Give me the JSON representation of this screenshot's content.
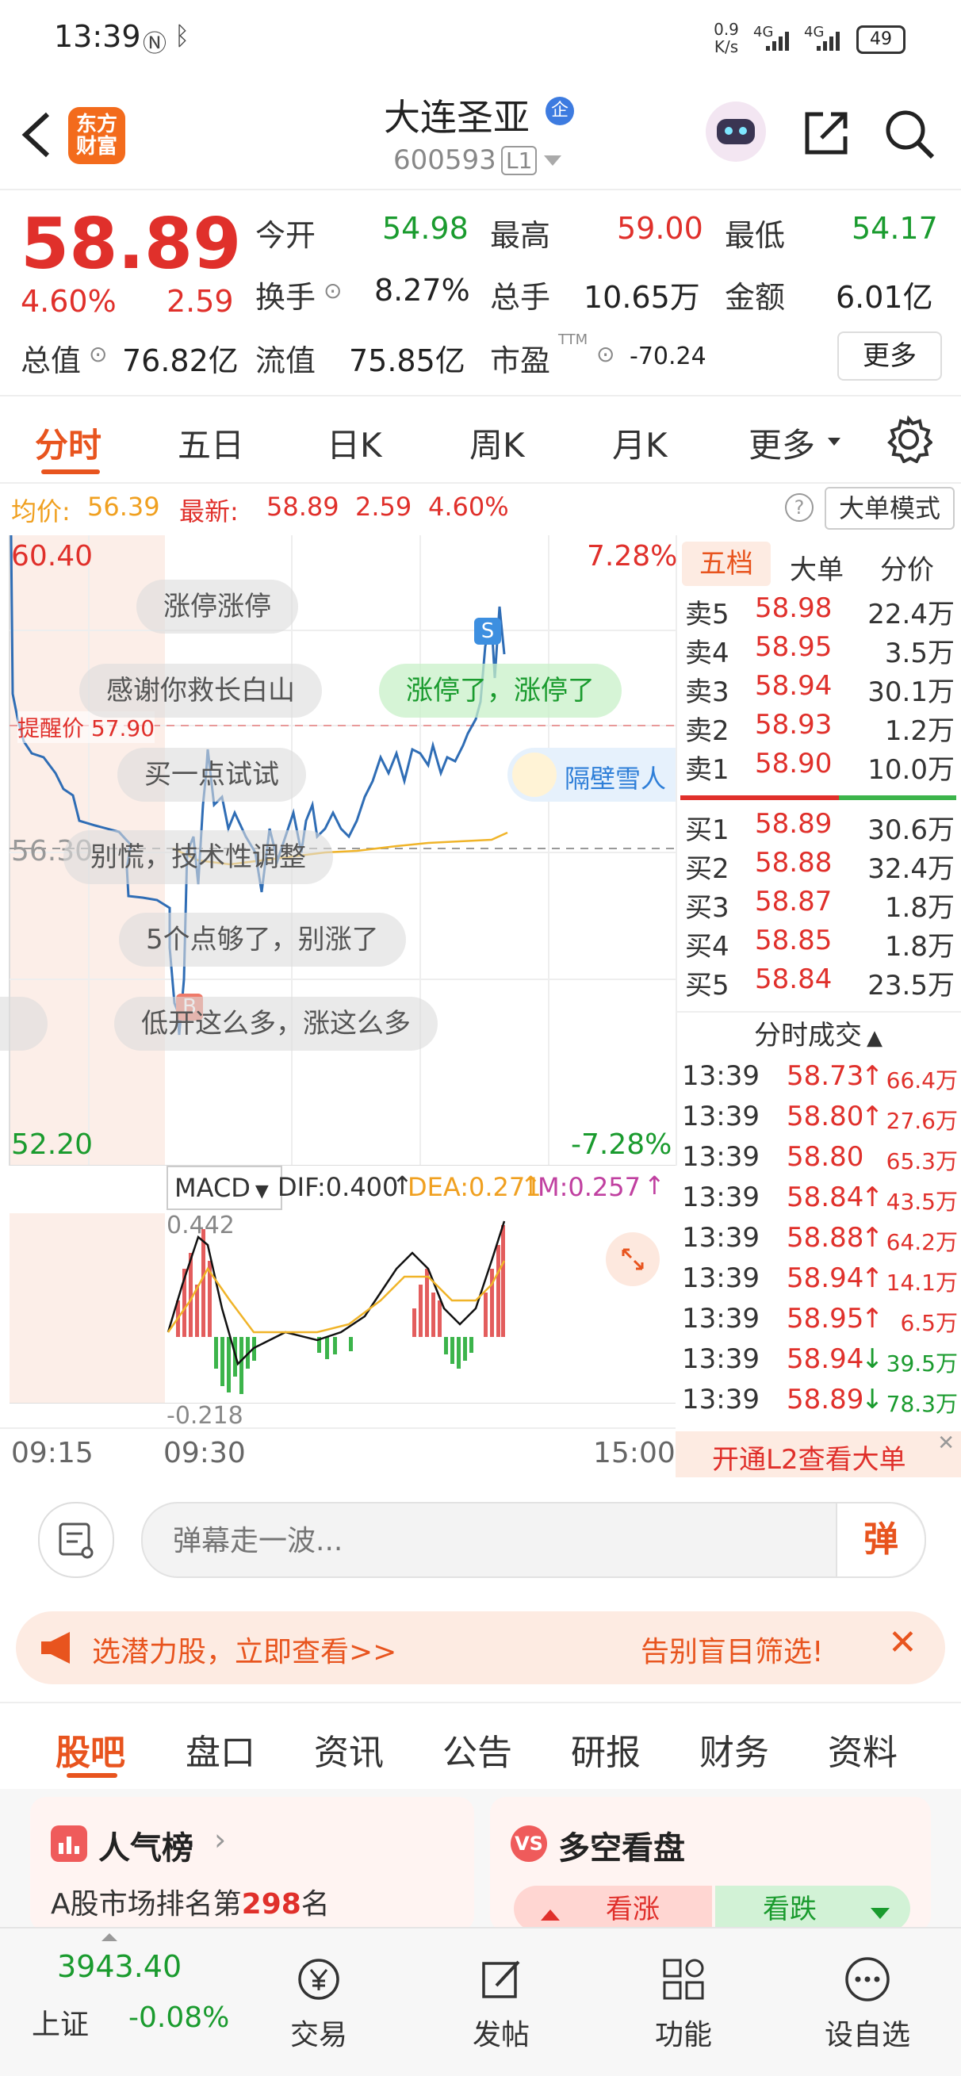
{
  "status_bar": {
    "time": "13:39",
    "net_speed_top": "0.9",
    "net_speed_unit": "K/s",
    "signal1": "4G",
    "signal2": "4G",
    "battery": "49"
  },
  "header": {
    "logo_text_line1": "东方",
    "logo_text_line2": "财富",
    "stock_name": "大连圣亚",
    "stock_code": "600593",
    "level": "L1",
    "badge": "企"
  },
  "quote": {
    "price": "58.89",
    "change_pct": "4.60%",
    "change": "2.59",
    "open_label": "今开",
    "open": "54.98",
    "high_label": "最高",
    "high": "59.00",
    "low_label": "最低",
    "low": "54.17",
    "turnover_label": "换手",
    "turnover": "8.27%",
    "volume_label": "总手",
    "volume": "10.65万",
    "amount_label": "金额",
    "amount": "6.01亿",
    "mktcap_label": "总值",
    "mktcap": "76.82亿",
    "float_label": "流值",
    "float": "75.85亿",
    "pe_label": "市盈",
    "pe_sup": "TTM",
    "pe": "-70.24",
    "more": "更多"
  },
  "tabs": [
    "分时",
    "五日",
    "日K",
    "周K",
    "月K",
    "更多"
  ],
  "avgline": {
    "avg_label": "均价:",
    "avg": "56.39",
    "latest_label": "最新:",
    "latest": "58.89",
    "change": "2.59",
    "pct": "4.60%",
    "big_order_mode": "大单模式"
  },
  "chart": {
    "y_top": "60.40",
    "y_mid": "56.30",
    "y_bottom": "52.20",
    "pct_top": "7.28%",
    "pct_bottom": "-7.28%",
    "alert_label": "提醒价 57.90",
    "marker_s": "S",
    "marker_b": "B",
    "time_start": "09:15",
    "time_open": "09:30",
    "time_end": "15:00",
    "macd_label": "MACD",
    "dif": "DIF:0.400",
    "dea": "DEA:0.271",
    "m": "M:0.257",
    "macd_top": "0.442",
    "macd_bottom": "-0.218",
    "side_user": "隔壁雪人"
  },
  "danmaku": [
    "涨停涨停",
    "感谢你救长白山",
    "涨停了，涨停了",
    "买一点试试",
    "别慌，技术性调整",
    "5个点够了，别涨了",
    "低开这么多，涨这么多"
  ],
  "orderbook": {
    "tabs": [
      "五档",
      "大单",
      "分价"
    ],
    "asks": [
      {
        "label": "卖5",
        "price": "58.98",
        "vol": "22.4万"
      },
      {
        "label": "卖4",
        "price": "58.95",
        "vol": "3.5万"
      },
      {
        "label": "卖3",
        "price": "58.94",
        "vol": "30.1万"
      },
      {
        "label": "卖2",
        "price": "58.93",
        "vol": "1.2万"
      },
      {
        "label": "卖1",
        "price": "58.90",
        "vol": "10.0万"
      }
    ],
    "bids": [
      {
        "label": "买1",
        "price": "58.89",
        "vol": "30.6万"
      },
      {
        "label": "买2",
        "price": "58.88",
        "vol": "32.4万"
      },
      {
        "label": "买3",
        "price": "58.87",
        "vol": "1.8万"
      },
      {
        "label": "买4",
        "price": "58.85",
        "vol": "1.8万"
      },
      {
        "label": "买5",
        "price": "58.84",
        "vol": "23.5万"
      }
    ],
    "trades_title": "分时成交",
    "trades": [
      {
        "time": "13:39",
        "price": "58.73",
        "arrow": "↑",
        "vol": "66.4万",
        "color": "red"
      },
      {
        "time": "13:39",
        "price": "58.80",
        "arrow": "↑",
        "vol": "27.6万",
        "color": "red"
      },
      {
        "time": "13:39",
        "price": "58.80",
        "arrow": "",
        "vol": "65.3万",
        "color": "red"
      },
      {
        "time": "13:39",
        "price": "58.84",
        "arrow": "↑",
        "vol": "43.5万",
        "color": "red"
      },
      {
        "time": "13:39",
        "price": "58.88",
        "arrow": "↑",
        "vol": "64.2万",
        "color": "red"
      },
      {
        "time": "13:39",
        "price": "58.94",
        "arrow": "↑",
        "vol": "14.1万",
        "color": "red"
      },
      {
        "time": "13:39",
        "price": "58.95",
        "arrow": "↑",
        "vol": "6.5万",
        "color": "red"
      },
      {
        "time": "13:39",
        "price": "58.94",
        "arrow": "↓",
        "vol": "39.5万",
        "color": "green"
      },
      {
        "time": "13:39",
        "price": "58.89",
        "arrow": "↓",
        "vol": "78.3万",
        "color": "green"
      }
    ],
    "l2_banner": "开通L2查看大单"
  },
  "danmaku_input": {
    "placeholder": "弹幕走一波...",
    "send_label": "弹"
  },
  "promo": {
    "left_text": "选潜力股，立即查看>>",
    "right_text": "告别盲目筛选!"
  },
  "section_tabs": [
    "股吧",
    "盘口",
    "资讯",
    "公告",
    "研报",
    "财务",
    "资料"
  ],
  "cards": {
    "popularity_title": "人气榜",
    "popularity_text_prefix": "A股市场排名第",
    "popularity_rank": "298",
    "popularity_text_suffix": "名",
    "longshort_title": "多空看盘",
    "bull_label": "看涨",
    "bear_label": "看跌"
  },
  "bottom_nav": {
    "index_value": "3943.40",
    "index_name": "上证",
    "index_change": "-0.08%",
    "items": [
      "交易",
      "发帖",
      "功能",
      "设自选"
    ]
  },
  "colors": {
    "up": "#e0302b",
    "down": "#1a9b2e",
    "brand": "#f36b1c",
    "accent_tab": "#e8541e",
    "price_line": "#2f6db5",
    "avg_line": "#f0b429"
  }
}
